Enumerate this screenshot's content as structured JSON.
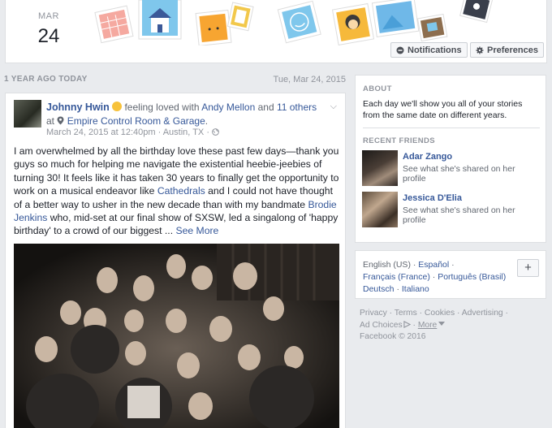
{
  "header": {
    "month": "MAR",
    "day": "24",
    "notifications_label": "Notifications",
    "preferences_label": "Preferences"
  },
  "memory": {
    "section_label": "1 YEAR AGO TODAY",
    "section_date": "Tue, Mar 24, 2015"
  },
  "post": {
    "author": "Johnny Hwin",
    "feeling": "feeling loved with",
    "tagged_friend": "Andy Mellon",
    "and_text": "and",
    "others": "11 others",
    "at_text": "at",
    "place": "Empire Control Room & Garage",
    "place_suffix": ".",
    "timestamp": "March 24, 2015 at 12:40pm",
    "location": "Austin, TX",
    "separator": "·",
    "text_part1": "I am overwhelmed by all the birthday love these past few days—thank you guys so much for helping me navigate the existential heebie-jeebies of turning 30! It feels like it has taken 30 years to finally get the opportunity to work on a musical endeavor like ",
    "text_link1": "Cathedrals",
    "text_part2": " and I could not have thought of a better way to usher in the new decade than with my bandmate ",
    "text_link2": "Brodie Jenkins",
    "text_part3": " who, mid-set at our final show of SXSW, led a singalong of 'happy birthday' to a crowd of our biggest ... ",
    "see_more": "See More"
  },
  "about": {
    "title": "ABOUT",
    "text": "Each day we'll show you all of your stories from the same date on different years."
  },
  "recent_friends": {
    "title": "RECENT FRIENDS",
    "items": [
      {
        "name": "Adar Zango",
        "desc": "See what she's shared on her profile"
      },
      {
        "name": "Jessica D'Elia",
        "desc": "See what she's shared on her profile"
      }
    ]
  },
  "languages": {
    "current": "English (US)",
    "dot": "·",
    "options": [
      "Español",
      "Français (France)",
      "Português (Brasil)",
      "Deutsch",
      "Italiano"
    ],
    "add_label": "+"
  },
  "footer": {
    "links": [
      "Privacy",
      "Terms",
      "Cookies",
      "Advertising",
      "Ad Choices",
      "More"
    ],
    "copyright": "Facebook © 2016"
  },
  "colors": {
    "link": "#365899",
    "background": "#e9ebee",
    "muted": "#90949c"
  }
}
